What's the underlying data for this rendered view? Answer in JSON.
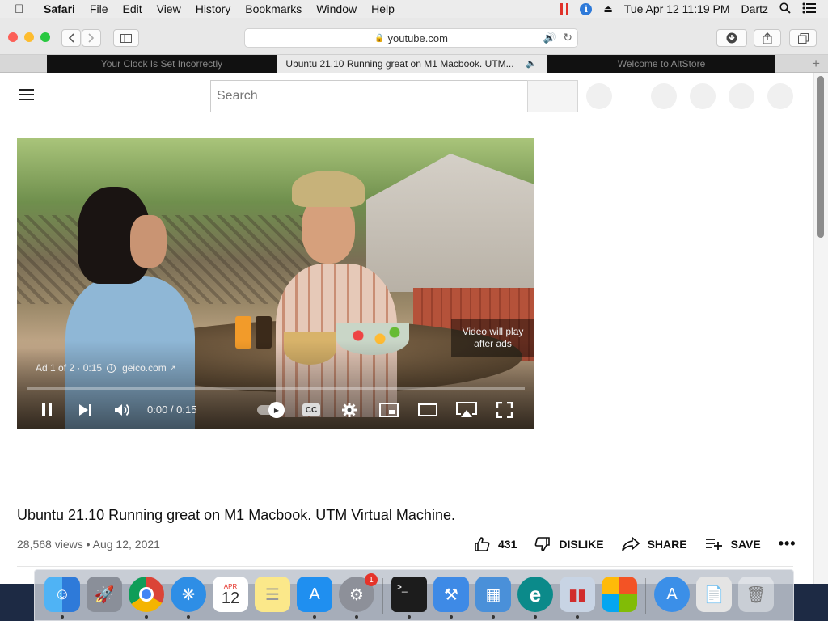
{
  "menubar": {
    "app_name": "Safari",
    "items": [
      "File",
      "Edit",
      "View",
      "History",
      "Bookmarks",
      "Window",
      "Help"
    ],
    "clock": "Tue Apr 12  11:19 PM",
    "user": "Dartz"
  },
  "browser": {
    "url": "youtube.com",
    "tabs": [
      {
        "title": "Your Clock Is Set Incorrectly"
      },
      {
        "title": "Ubuntu 21.10 Running great on M1 Macbook. UTM..."
      },
      {
        "title": "Welcome to AltStore"
      }
    ]
  },
  "youtube": {
    "search_placeholder": "Search",
    "player": {
      "ad_label": "Ad 1 of 2 · 0:15",
      "ad_domain": "geico.com",
      "ad_note": "Video will play after ads",
      "time": "0:00 / 0:15",
      "cc_label": "CC",
      "progress": 0.0
    },
    "video": {
      "title": "Ubuntu 21.10 Running great on M1 Macbook. UTM Virtual Machine.",
      "meta": "28,568 views • Aug 12, 2021",
      "likes": "431",
      "dislike_label": "DISLIKE",
      "share_label": "SHARE",
      "save_label": "SAVE"
    }
  },
  "dock": {
    "calendar_month": "APR",
    "calendar_day": "12",
    "settings_badge": "1"
  },
  "colors": {
    "accent_blue": "#2e7ad9",
    "ad_progress": "#ffcc00",
    "traffic_red": "#fc5f57",
    "traffic_yellow": "#fdbc2e",
    "traffic_green": "#28c840"
  }
}
